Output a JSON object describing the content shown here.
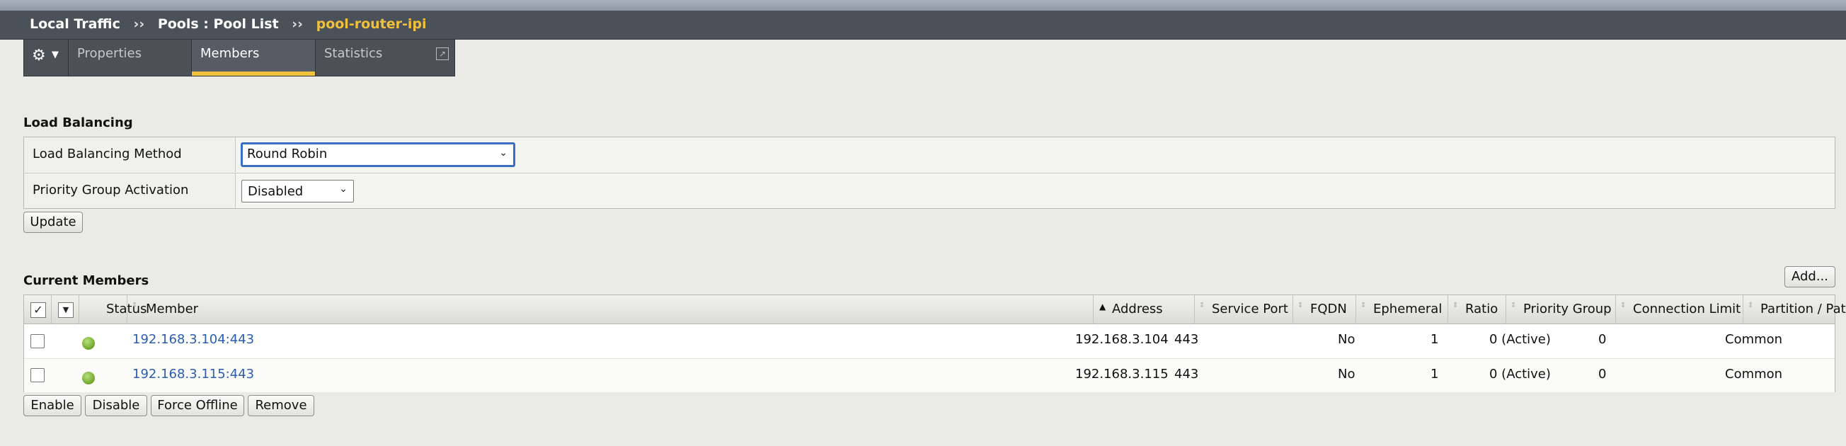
{
  "breadcrumb": {
    "items": [
      "Local Traffic",
      "Pools : Pool List"
    ],
    "separator": "››",
    "current": "pool-router-ipi"
  },
  "tabs": {
    "gear_icon": "gear-icon",
    "items": [
      {
        "label": "Properties",
        "active": false
      },
      {
        "label": "Members",
        "active": true
      },
      {
        "label": "Statistics",
        "active": false
      }
    ],
    "popout_icon": "external-window-icon"
  },
  "load_balancing": {
    "title": "Load Balancing",
    "method_label": "Load Balancing Method",
    "method_value": "Round Robin",
    "priority_label": "Priority Group Activation",
    "priority_value": "Disabled",
    "update_label": "Update"
  },
  "members": {
    "title": "Current Members",
    "add_label": "Add...",
    "columns": [
      "Status",
      "Member",
      "Address",
      "Service Port",
      "FQDN",
      "Ephemeral",
      "Ratio",
      "Priority Group",
      "Connection Limit",
      "Partition / Path"
    ],
    "sorted_column": "Address",
    "rows": [
      {
        "status": "available",
        "member": "192.168.3.104:443",
        "address": "192.168.3.104",
        "service_port": "443",
        "fqdn": "",
        "ephemeral": "No",
        "ratio": "1",
        "priority_group": "0  (Active)",
        "connection_limit": "0",
        "partition": "Common"
      },
      {
        "status": "available",
        "member": "192.168.3.115:443",
        "address": "192.168.3.115",
        "service_port": "443",
        "fqdn": "",
        "ephemeral": "No",
        "ratio": "1",
        "priority_group": "0  (Active)",
        "connection_limit": "0",
        "partition": "Common"
      }
    ],
    "actions": {
      "enable": "Enable",
      "disable": "Disable",
      "force_offline": "Force Offline",
      "remove": "Remove"
    }
  },
  "colors": {
    "accent": "#f2c13b",
    "link": "#2a5db0",
    "status_available": "#6fa52a"
  }
}
